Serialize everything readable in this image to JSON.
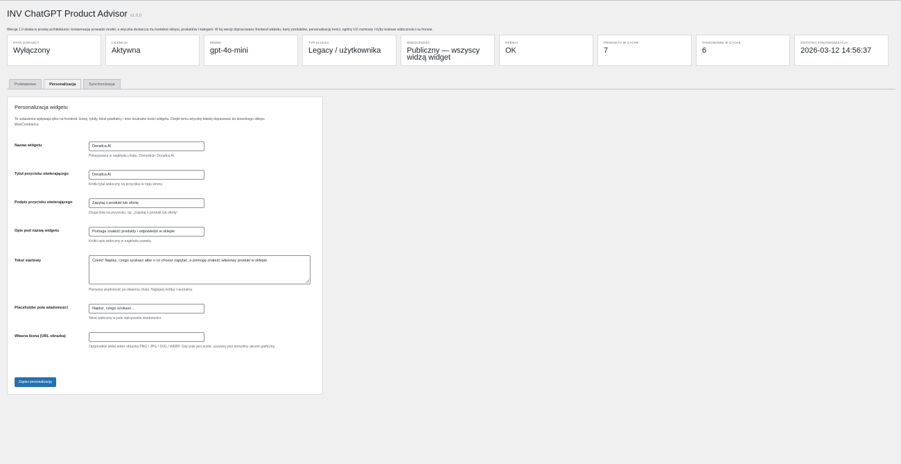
{
  "header": {
    "title": "INV ChatGPT Product Advisor",
    "version": "v1.0.0",
    "intro": "Wersja 1.0 działa w prostej architekturze: konwersację prowadzi model, a wtyczka dostarcza mu kontekst sklepu, produktów i kategorii. W tej wersji dopracowano frontend widżetu, karty produktów, personalizację treści, ogólny UX rozmowy i tryby testowe widoczności na froncie."
  },
  "cards": [
    {
      "label": "Stan doradcy",
      "value": "Wyłączony"
    },
    {
      "label": "Licencja",
      "value": "Aktywna"
    },
    {
      "label": "Model",
      "value": "gpt-4o-mini"
    },
    {
      "label": "Typ klucza",
      "value": "Legacy / użytkownika"
    },
    {
      "label": "Widoczność",
      "value": "Publiczny — wszyscy widzą widget"
    },
    {
      "label": "OpenAI",
      "value": "OK"
    },
    {
      "label": "Produkty w cache",
      "value": "7"
    },
    {
      "label": "Taksonomie w cache",
      "value": "6"
    },
    {
      "label": "Ostatnia synchronizacja",
      "value": "2026-03-12 14:56:37"
    }
  ],
  "tabs": [
    {
      "label": "Podstawowe",
      "active": false
    },
    {
      "label": "Personalizacja",
      "active": true
    },
    {
      "label": "Synchronizacja",
      "active": false
    }
  ],
  "panel": {
    "title": "Personalizacja widgetu",
    "description": "Te ustawienia wpływają tylko na frontend: ikonę, tytuły, tekst powitalny i inne neutralne treści widgetu. Dzięki temu wtyczkę łatwiej dopasować do dowolnego sklepu WooCommerce.",
    "fields": {
      "widget_name": {
        "label": "Nazwa widgetu",
        "value": "Doradca AI",
        "help": "Pokazywana w nagłówku chatu. Domyślnie: Doradca AI."
      },
      "button_title": {
        "label": "Tytuł przycisku otwierającego",
        "value": "Doradca AI",
        "help": "Krótki tytuł widoczny na przycisku w rogu strony."
      },
      "button_subtitle": {
        "label": "Podpis przycisku otwierającego",
        "value": "Zapytaj o produkt lub ofertę",
        "help": "Druga linia na przycisku, np. „Zapytaj o produkt lub ofertę”."
      },
      "widget_desc": {
        "label": "Opis pod nazwą widgetu",
        "value": "Pomaga znaleźć produkty i odpowiedzi w sklepie",
        "help": "Krótki opis widoczny w nagłówku panelu."
      },
      "start_text": {
        "label": "Tekst startowy",
        "value": "Cześć! Napisz, czego szukasz albo o co chcesz zapytać, a pomogę znaleźć właściwy produkt w sklepie.",
        "help": "Pierwsza wiadomość po otwarciu chatu. Najlepiej krótka i neutralna."
      },
      "placeholder": {
        "label": "Placeholder pola wiadomości",
        "value": "Napisz, czego szukasz...",
        "help": "Tekst widoczny w polu wpisywania wiadomości."
      },
      "icon_url": {
        "label": "Własna ikona (URL obrazka)",
        "value": "",
        "help": "Opcjonalnie wklej adres obrazka PNG / JPG / SVG / WEBP. Gdy pole jest puste, używany jest domyślny akcent graficzny."
      }
    },
    "save_label": "Zapisz personalizację"
  }
}
